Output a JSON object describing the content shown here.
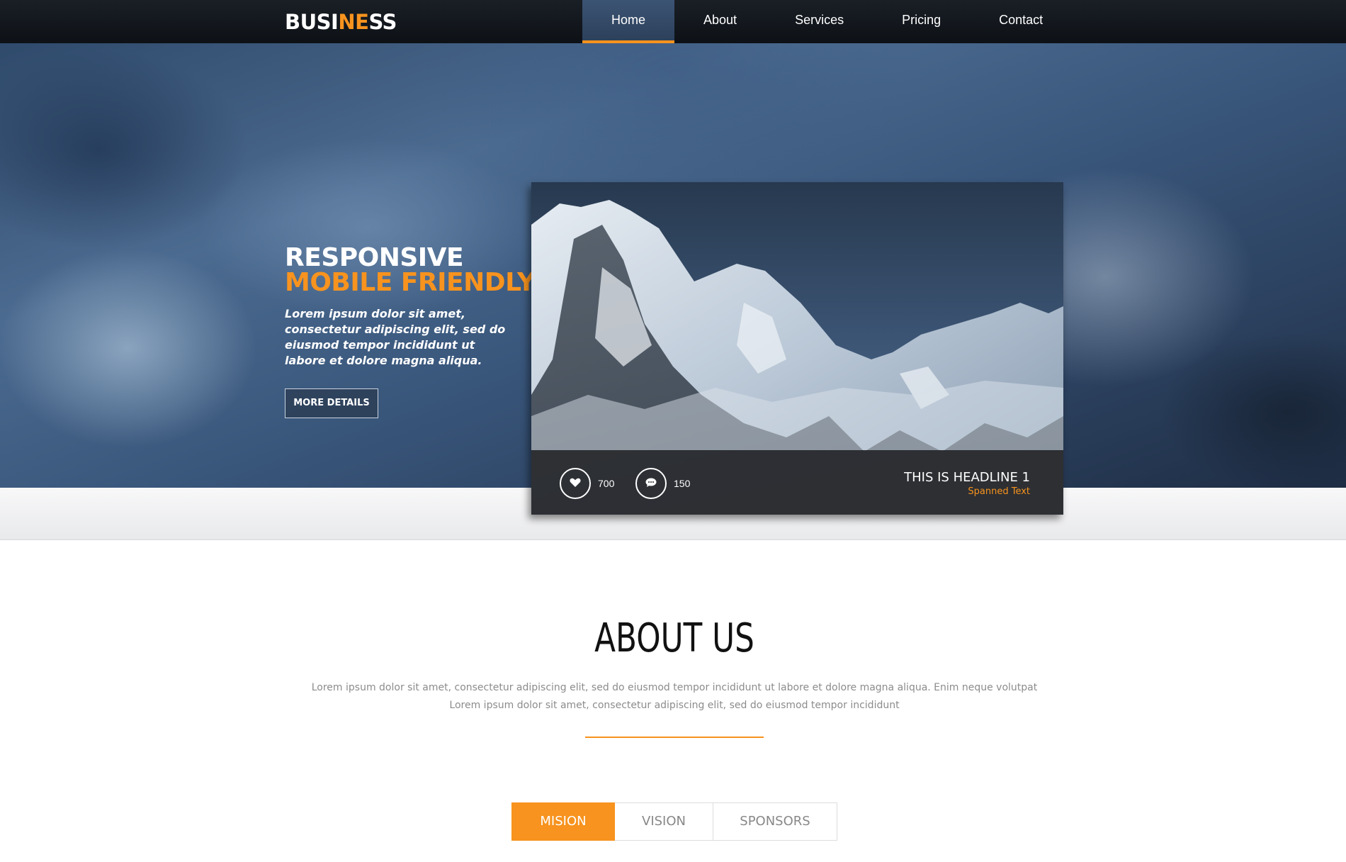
{
  "brand": {
    "part1": "BUSI",
    "part2": "NE",
    "part3": "SS",
    "accent_color": "#f7931e"
  },
  "nav": {
    "items": [
      {
        "label": "Home",
        "active": true
      },
      {
        "label": "About",
        "active": false
      },
      {
        "label": "Services",
        "active": false
      },
      {
        "label": "Pricing",
        "active": false
      },
      {
        "label": "Contact",
        "active": false
      }
    ]
  },
  "hero": {
    "title_line1": "RESPONSIVE",
    "title_line2": "MOBILE FRIENDLY",
    "description": "Lorem ipsum dolor sit amet, consectetur adipiscing elit, sed do eiusmod tempor incididunt ut labore et dolore magna aliqua.",
    "button_label": "MORE DETAILS"
  },
  "card": {
    "likes": "700",
    "comments": "150",
    "headline": "THIS IS HEADLINE 1",
    "subtext": "Spanned Text",
    "like_icon": "heart-icon",
    "comment_icon": "comment-icon"
  },
  "about": {
    "title": "ABOUT US",
    "text_line1": "Lorem ipsum dolor sit amet, consectetur adipiscing elit, sed do eiusmod tempor incididunt ut labore et dolore magna aliqua. Enim neque volutpat",
    "text_line2": "Lorem ipsum dolor sit amet, consectetur adipiscing elit, sed do eiusmod tempor incididunt"
  },
  "tabs": [
    {
      "label": "MISION",
      "active": true
    },
    {
      "label": "VISION",
      "active": false
    },
    {
      "label": "SPONSORS",
      "active": false
    }
  ]
}
